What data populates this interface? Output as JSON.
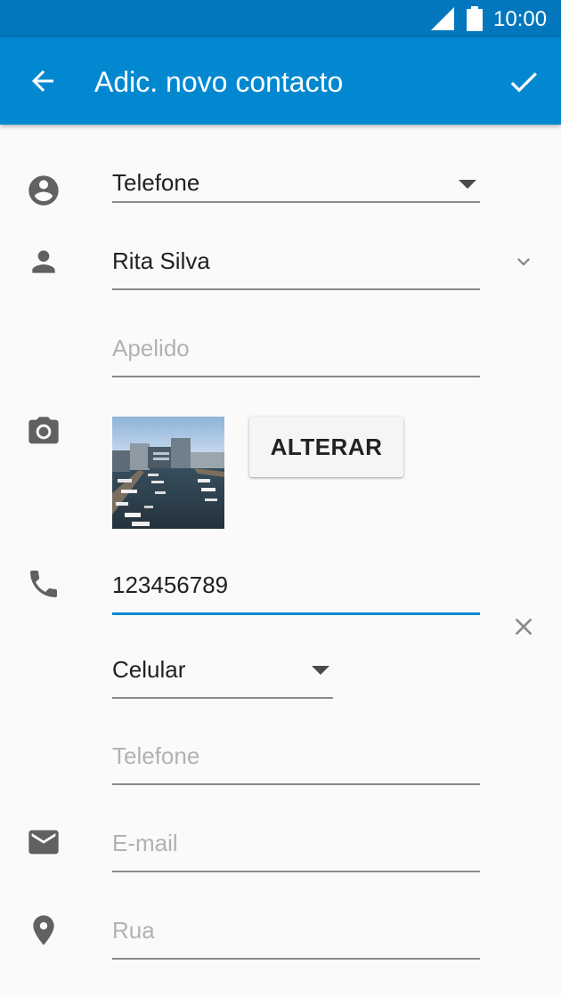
{
  "status_bar": {
    "time": "10:00"
  },
  "app_bar": {
    "title": "Adic. novo contacto"
  },
  "account": {
    "value": "Telefone"
  },
  "name": {
    "value": "Rita Silva"
  },
  "surname": {
    "placeholder": "Apelido"
  },
  "photo": {
    "change_label": "ALTERAR"
  },
  "phone": {
    "value": "123456789",
    "type": "Celular"
  },
  "phone2": {
    "placeholder": "Telefone"
  },
  "email": {
    "placeholder": "E-mail"
  },
  "address": {
    "placeholder": "Rua"
  },
  "colors": {
    "primary": "#0288d1",
    "status_bar": "#0277bd",
    "icon": "#616161"
  }
}
